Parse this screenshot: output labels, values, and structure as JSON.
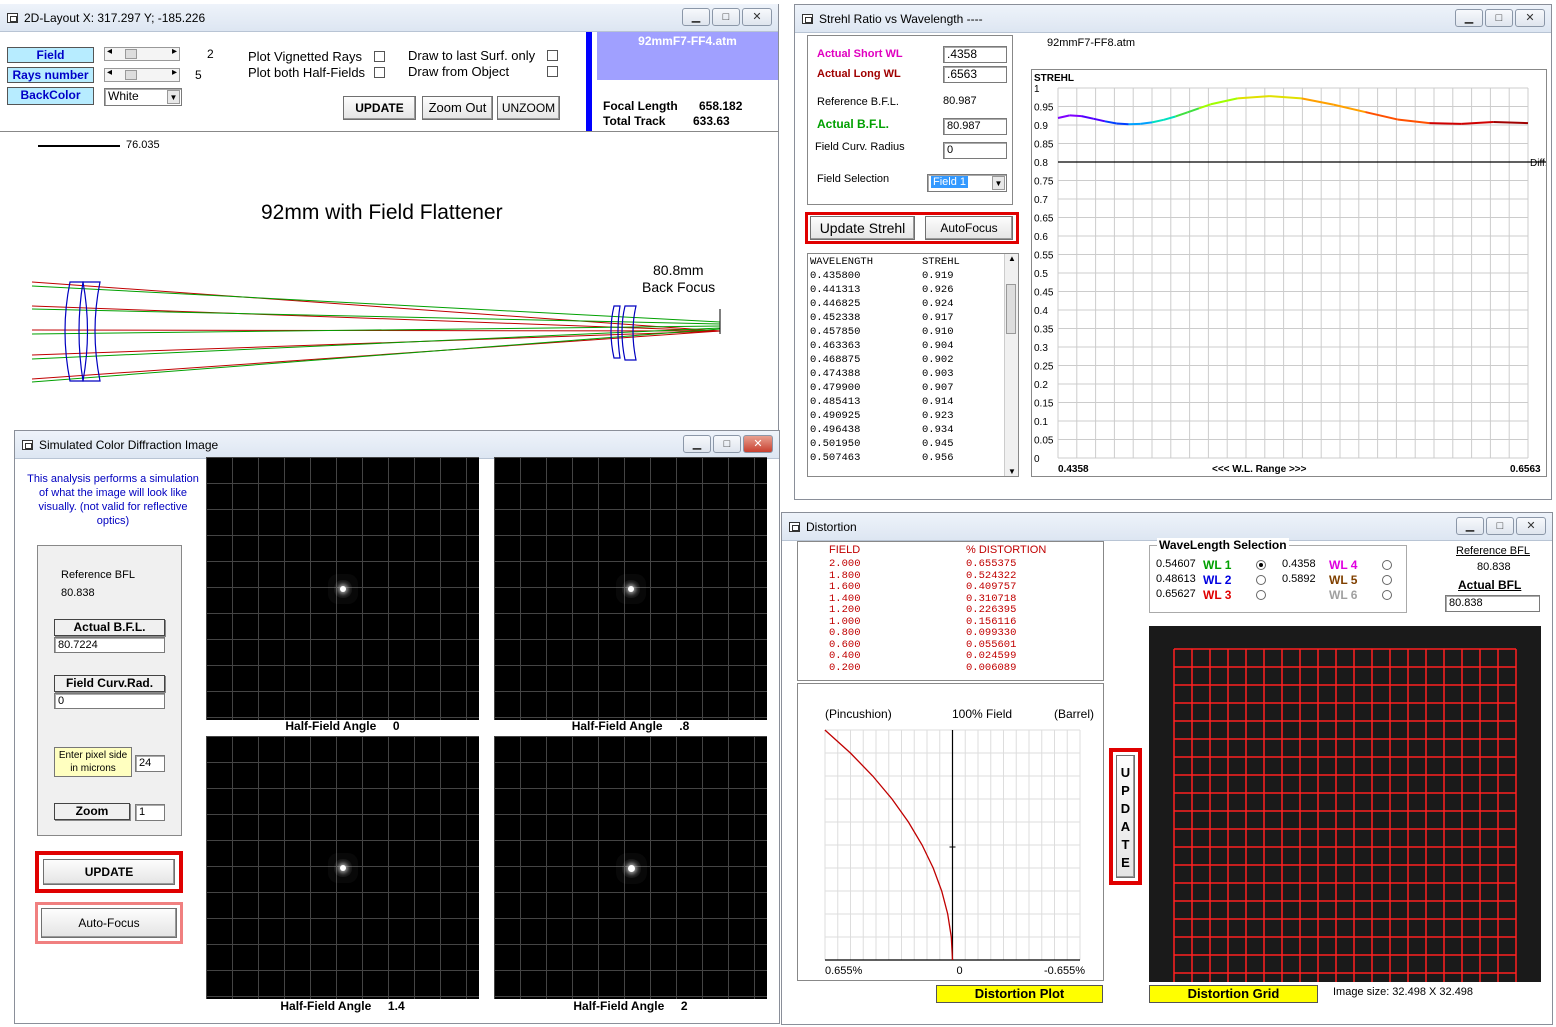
{
  "layout_win": {
    "title": "2D-Layout  X: 317.297  Y;  -185.226",
    "field_label": "Field",
    "field_value": "2",
    "rays_label": "Rays number",
    "rays_value": "5",
    "backcolor_label": "BackColor",
    "backcolor_value": "White",
    "plot_vignetted": "Plot Vignetted Rays",
    "plot_half": "Plot both Half-Fields",
    "draw_last": "Draw to last Surf. only",
    "draw_object": "Draw from Object",
    "update": "UPDATE",
    "zoom_out": "Zoom Out",
    "unzoom": "UNZOOM",
    "file": "92mmF7-FF4.atm",
    "focal_label": "Focal Length",
    "focal_value": "658.182",
    "track_label": "Total Track",
    "track_value": "633.63",
    "scale_value": "76.035",
    "drawing_title": "92mm with Field Flattener",
    "back_focus_1": "80.8mm",
    "back_focus_2": "Back Focus"
  },
  "strehl_win": {
    "title": "Strehl Ratio vs Wavelength  ----",
    "short_wl_label": "Actual Short WL",
    "short_wl": ".4358",
    "long_wl_label": "Actual Long WL",
    "long_wl": ".6563",
    "ref_bfl_label": "Reference   B.F.L.",
    "ref_bfl": "80.987",
    "act_bfl_label": "Actual   B.F.L.",
    "act_bfl": "80.987",
    "fcr_label": "Field Curv. Radius",
    "fcr": "0",
    "fsel_label": "Field Selection",
    "fsel": "Field 1",
    "update": "Update Strehl",
    "autofocus": "AutoFocus",
    "file": "92mmF7-FF8.atm",
    "col1": "WAVELENGTH",
    "col2": "STREHL",
    "rows": [
      [
        "0.435800",
        "0.919"
      ],
      [
        "0.441313",
        "0.926"
      ],
      [
        "0.446825",
        "0.924"
      ],
      [
        "0.452338",
        "0.917"
      ],
      [
        "0.457850",
        "0.910"
      ],
      [
        "0.463363",
        "0.904"
      ],
      [
        "0.468875",
        "0.902"
      ],
      [
        "0.474388",
        "0.903"
      ],
      [
        "0.479900",
        "0.907"
      ],
      [
        "0.485413",
        "0.914"
      ],
      [
        "0.490925",
        "0.923"
      ],
      [
        "0.496438",
        "0.934"
      ],
      [
        "0.501950",
        "0.945"
      ],
      [
        "0.507463",
        "0.956"
      ]
    ],
    "chart_ylabel": "STREHL",
    "chart_xmin": "0.4358",
    "chart_xmax": "0.6563",
    "chart_xlabel": "<<<  W.L. Range  >>>",
    "diff_label": "Diff.L",
    "yticks": [
      "1",
      "0.95",
      "0.9",
      "0.85",
      "0.8",
      "0.75",
      "0.7",
      "0.65",
      "0.6",
      "0.55",
      "0.5",
      "0.45",
      "0.4",
      "0.35",
      "0.3",
      "0.25",
      "0.2",
      "0.15",
      "0.1",
      "0.05",
      "0"
    ]
  },
  "sim_win": {
    "title": "Simulated Color Diffraction Image",
    "desc": "This analysis performs a simulation of what the image will look like visually. (not valid for reflective optics)",
    "ref_bfl_label": "Reference BFL",
    "ref_bfl": "80.838",
    "act_bfl_label": "Actual  B.F.L.",
    "act_bfl": "80.7224",
    "fcr_label": "Field Curv.Rad.",
    "fcr": "0",
    "pixel_label": "Enter pixel side in microns",
    "pixel": "24",
    "zoom_label": "Zoom",
    "zoom": "1",
    "update": "UPDATE",
    "autofocus": "Auto-Focus",
    "captions": [
      "Half-Field Angle     0",
      "Half-Field Angle     .8",
      "Half-Field Angle     1.4",
      "Half-Field Angle     2"
    ]
  },
  "dist_win": {
    "title": "Distortion",
    "col1": "FIELD",
    "col2": "% DISTORTION",
    "rows": [
      [
        "2.000",
        "0.655375"
      ],
      [
        "1.800",
        "0.524322"
      ],
      [
        "1.600",
        "0.409757"
      ],
      [
        "1.400",
        "0.310718"
      ],
      [
        "1.200",
        "0.226395"
      ],
      [
        "1.000",
        "0.156116"
      ],
      [
        "0.800",
        "0.099330"
      ],
      [
        "0.600",
        "0.055601"
      ],
      [
        "0.400",
        "0.024599"
      ],
      [
        "0.200",
        "0.006089"
      ]
    ],
    "wl_title": "WaveLength Selection",
    "wls": [
      [
        "0.54607",
        "WL  1"
      ],
      [
        "0.48613",
        "WL  2"
      ],
      [
        "0.65627",
        "WL  3"
      ],
      [
        "0.4358",
        "WL  4"
      ],
      [
        "0.5892",
        "WL  5"
      ],
      [
        "",
        "WL  6"
      ]
    ],
    "ref_bfl_label": "Reference  BFL",
    "ref_bfl": "80.838",
    "act_bfl_label": "Actual   BFL",
    "act_bfl": "80.838",
    "pin": "(Pincushion)",
    "field100": "100% Field",
    "barrel": "(Barrel)",
    "x_left": "0.655%",
    "x_mid": "0",
    "x_right": "-0.655%",
    "update_letters": [
      "U",
      "P",
      "D",
      "A",
      "T",
      "E"
    ],
    "plot_label": "Distortion  Plot",
    "grid_label": "Distortion  Grid",
    "image_size": "Image size: 32.498 X 32.498"
  }
}
